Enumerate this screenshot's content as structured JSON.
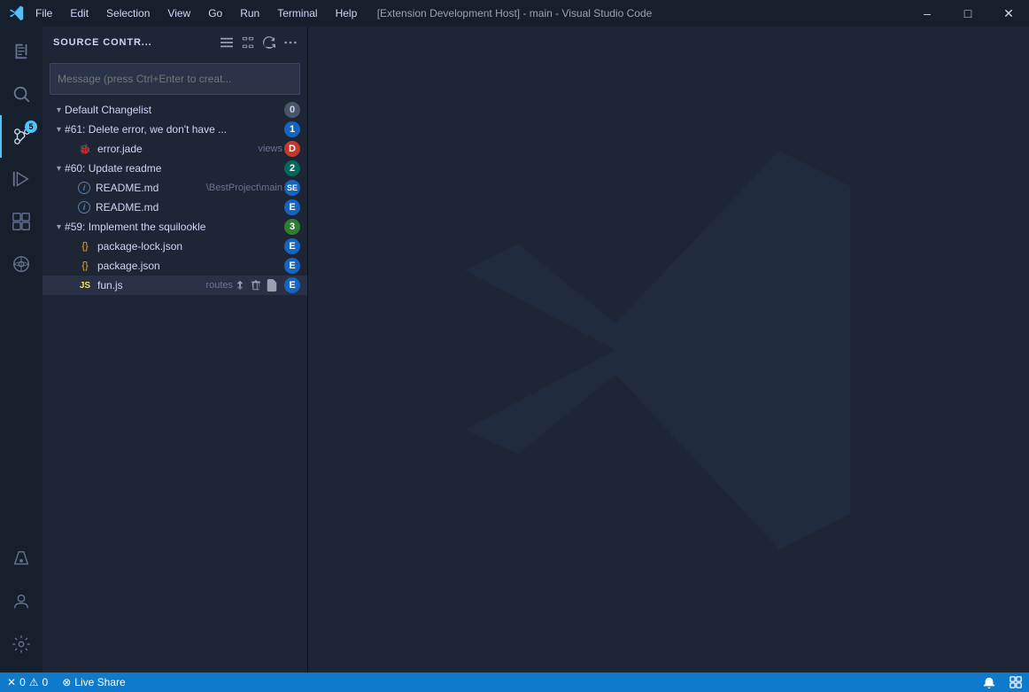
{
  "titlebar": {
    "menu_items": [
      "File",
      "Edit",
      "Selection",
      "View",
      "Go",
      "Run",
      "Terminal",
      "Help"
    ],
    "title": "[Extension Development Host] - main - Visual Studio Code",
    "min_label": "—",
    "max_label": "🗖",
    "close_label": "✕"
  },
  "activity_bar": {
    "items": [
      {
        "name": "explorer",
        "icon": "files",
        "active": false
      },
      {
        "name": "search",
        "icon": "search",
        "active": false
      },
      {
        "name": "source-control",
        "icon": "source-control",
        "active": true,
        "badge": "5"
      },
      {
        "name": "run",
        "icon": "run",
        "active": false
      },
      {
        "name": "extensions",
        "icon": "extensions",
        "active": false
      },
      {
        "name": "remote",
        "icon": "remote",
        "active": false
      }
    ],
    "bottom_items": [
      {
        "name": "testing",
        "icon": "testing"
      },
      {
        "name": "accounts",
        "icon": "accounts"
      },
      {
        "name": "settings",
        "icon": "settings"
      }
    ]
  },
  "sidebar": {
    "title": "SOURCE CONTR...",
    "actions": [
      "list-icon",
      "expand-all-icon",
      "refresh-icon",
      "more-icon"
    ],
    "commit_placeholder": "Message (press Ctrl+Enter to creat...",
    "groups": [
      {
        "name": "Default Changelist",
        "badge": "0",
        "badge_class": "badge-gray",
        "expanded": true,
        "items": []
      },
      {
        "name": "#61: Delete error, we don't have ...",
        "badge": "1",
        "badge_class": "badge-blue",
        "expanded": true,
        "items": [
          {
            "filename": "error.jade",
            "path": "views",
            "icon_type": "jade",
            "badge": "D",
            "badge_class": "badge-D",
            "indent": 2,
            "active": false
          }
        ]
      },
      {
        "name": "#60: Update readme",
        "badge": "2",
        "badge_class": "badge-teal",
        "expanded": true,
        "items": [
          {
            "filename": "README.md",
            "path": "\\BestProject\\main",
            "icon_type": "info",
            "badge": "SE",
            "badge_class": "badge-SE",
            "indent": 2,
            "active": false
          },
          {
            "filename": "README.md",
            "path": "",
            "icon_type": "info",
            "badge": "E",
            "badge_class": "badge-E",
            "indent": 2,
            "active": false
          }
        ]
      },
      {
        "name": "#59: Implement the squilookle",
        "badge": "3",
        "badge_class": "badge-green",
        "expanded": true,
        "items": [
          {
            "filename": "package-lock.json",
            "path": "",
            "icon_type": "json",
            "badge": "E",
            "badge_class": "badge-E",
            "indent": 2,
            "active": false
          },
          {
            "filename": "package.json",
            "path": "",
            "icon_type": "json",
            "badge": "E",
            "badge_class": "badge-E",
            "indent": 2,
            "active": false
          },
          {
            "filename": "fun.js",
            "path": "routes",
            "icon_type": "js",
            "badge": "E",
            "badge_class": "badge-E",
            "indent": 2,
            "active": true,
            "has_actions": true
          }
        ]
      }
    ]
  },
  "statusbar": {
    "errors": "0",
    "warnings": "0",
    "live_share": "Live Share",
    "error_icon": "✕",
    "warning_icon": "⚠",
    "broadcast_icon": "⊗"
  }
}
